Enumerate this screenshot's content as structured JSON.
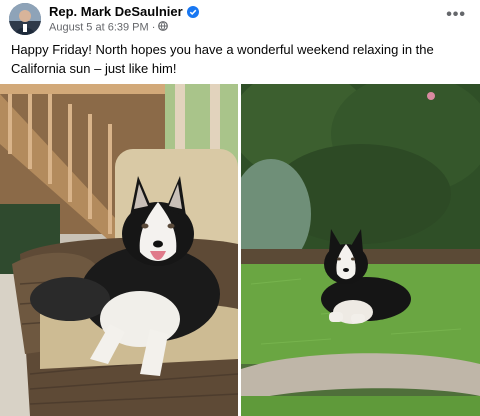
{
  "post": {
    "author": "Rep. Mark DeSaulnier",
    "timestamp": "August 5 at 6:39 PM",
    "separator": "·",
    "text": "Happy Friday! North hopes you have a wonderful weekend relaxing in the California sun – just like him!",
    "more_icon": "ellipsis-icon",
    "audience_icon": "globe-icon",
    "verified_icon": "verified-badge-icon"
  },
  "colors": {
    "verified": "#1877f2",
    "meta": "#65676b"
  }
}
